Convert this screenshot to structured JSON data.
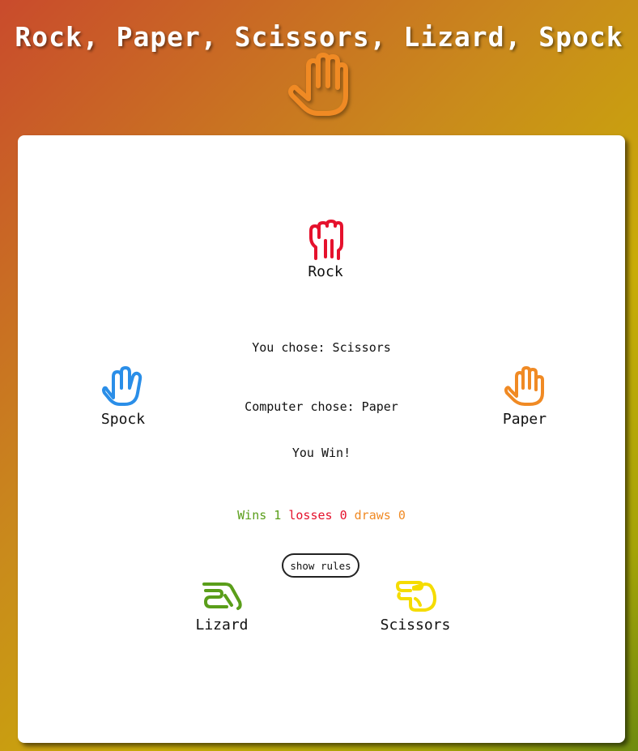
{
  "header": {
    "title": "Rock, Paper, Scissors, Lizard, Spock",
    "logo_icon": "raised-hand-icon",
    "logo_color": "#f08a24"
  },
  "choices": [
    {
      "label": "Rock",
      "icon": "fist-icon",
      "color": "#e5122d"
    },
    {
      "label": "Paper",
      "icon": "hand-icon",
      "color": "#f08a24"
    },
    {
      "label": "Scissors",
      "icon": "scissors-hand-icon",
      "color": "#f5dc00"
    },
    {
      "label": "Lizard",
      "icon": "lizard-hand-icon",
      "color": "#5a9e1a"
    },
    {
      "label": "Spock",
      "icon": "vulcan-salute-icon",
      "color": "#2a8ee8"
    }
  ],
  "result": {
    "you_chose": "You chose: Scissors",
    "computer_chose": "Computer chose: Paper",
    "outcome": "You Win!"
  },
  "score": {
    "wins_label": "Wins",
    "wins": "1",
    "wins_color": "#5a9e1a",
    "losses_label": "losses",
    "losses": "0",
    "losses_color": "#e5122d",
    "draws_label": "draws",
    "draws": "0",
    "draws_color": "#f08a24"
  },
  "rules_button": "show rules"
}
